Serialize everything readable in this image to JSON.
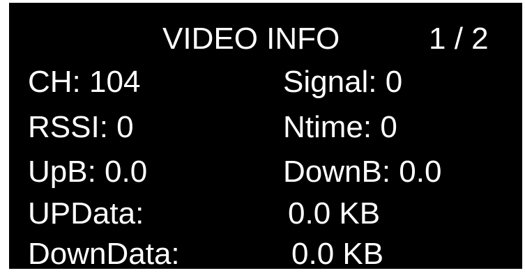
{
  "header": {
    "title": "VIDEO INFO",
    "page_indicator": "1 / 2"
  },
  "rows": [
    {
      "left": "CH: 104",
      "right": "Signal: 0"
    },
    {
      "left": "RSSI: 0",
      "right": "Ntime: 0"
    },
    {
      "left": "UpB: 0.0",
      "right": "DownB: 0.0"
    },
    {
      "left": "UPData:",
      "right": "0.0 KB"
    },
    {
      "left": "DownData:",
      "right": "0.0 KB"
    }
  ]
}
